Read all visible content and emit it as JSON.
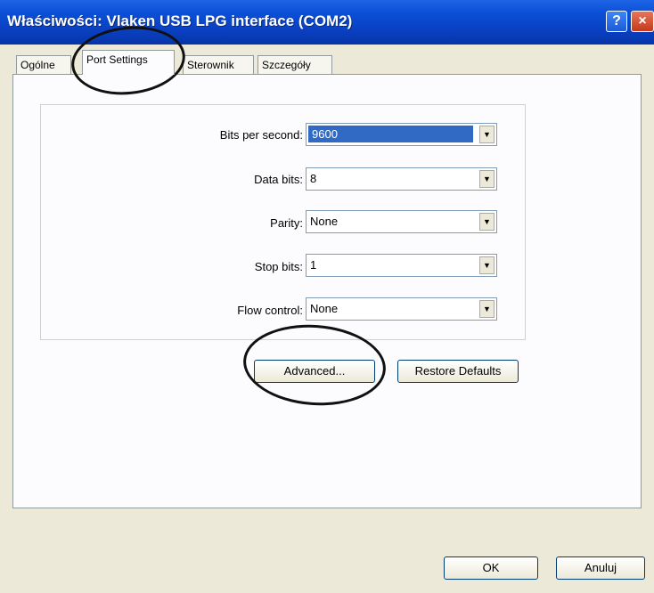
{
  "window": {
    "title": "Właściwości: Vlaken USB LPG interface (COM2)",
    "help_icon": "?",
    "close_icon": "×"
  },
  "tabs": [
    {
      "label": "Ogólne",
      "active": false
    },
    {
      "label": "Port Settings",
      "active": true
    },
    {
      "label": "Sterownik",
      "active": false
    },
    {
      "label": "Szczegóły",
      "active": false
    }
  ],
  "port_settings": {
    "bits_per_second": {
      "label": "Bits per second:",
      "value": "9600"
    },
    "data_bits": {
      "label": "Data bits:",
      "value": "8"
    },
    "parity": {
      "label": "Parity:",
      "value": "None"
    },
    "stop_bits": {
      "label": "Stop bits:",
      "value": "1"
    },
    "flow_control": {
      "label": "Flow control:",
      "value": "None"
    },
    "dropdown_icon": "▼"
  },
  "buttons": {
    "advanced": "Advanced...",
    "restore_defaults": "Restore Defaults",
    "ok": "OK",
    "cancel": "Anuluj"
  },
  "colors": {
    "titlebar": "#0a4fd6",
    "selection": "#316ac5",
    "dialog_bg": "#ece9d8"
  }
}
